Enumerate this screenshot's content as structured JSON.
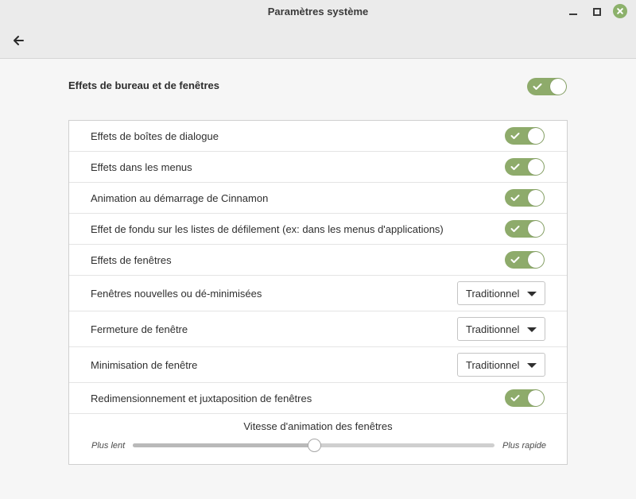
{
  "window": {
    "title": "Paramètres système"
  },
  "section": {
    "title": "Effets de bureau et de fenêtres",
    "enabled": true
  },
  "settings": {
    "dialog_effects": {
      "label": "Effets de boîtes de dialogue",
      "enabled": true
    },
    "menu_effects": {
      "label": "Effets dans les menus",
      "enabled": true
    },
    "startup_animation": {
      "label": "Animation au démarrage de Cinnamon",
      "enabled": true
    },
    "fade_effect": {
      "label": "Effet de fondu sur les listes de défilement (ex: dans les menus d'applications)",
      "enabled": true
    },
    "window_effects": {
      "label": "Effets de fenêtres",
      "enabled": true
    },
    "new_windows": {
      "label": "Fenêtres nouvelles ou dé-minimisées",
      "value": "Traditionnel"
    },
    "close_window": {
      "label": "Fermeture de fenêtre",
      "value": "Traditionnel"
    },
    "minimize_window": {
      "label": "Minimisation de fenêtre",
      "value": "Traditionnel"
    },
    "resize_tile": {
      "label": "Redimensionnement et juxtaposition de fenêtres",
      "enabled": true
    }
  },
  "animation_speed": {
    "title": "Vitesse d'animation des fenêtres",
    "min_label": "Plus lent",
    "max_label": "Plus rapide",
    "value": 0.5
  },
  "colors": {
    "accent": "#8eab6b",
    "close_button": "#8cb16b"
  },
  "icons": {
    "back": "arrow-left-icon",
    "minimize": "minimize-icon",
    "maximize": "maximize-icon",
    "close": "close-icon",
    "check": "check-icon"
  }
}
